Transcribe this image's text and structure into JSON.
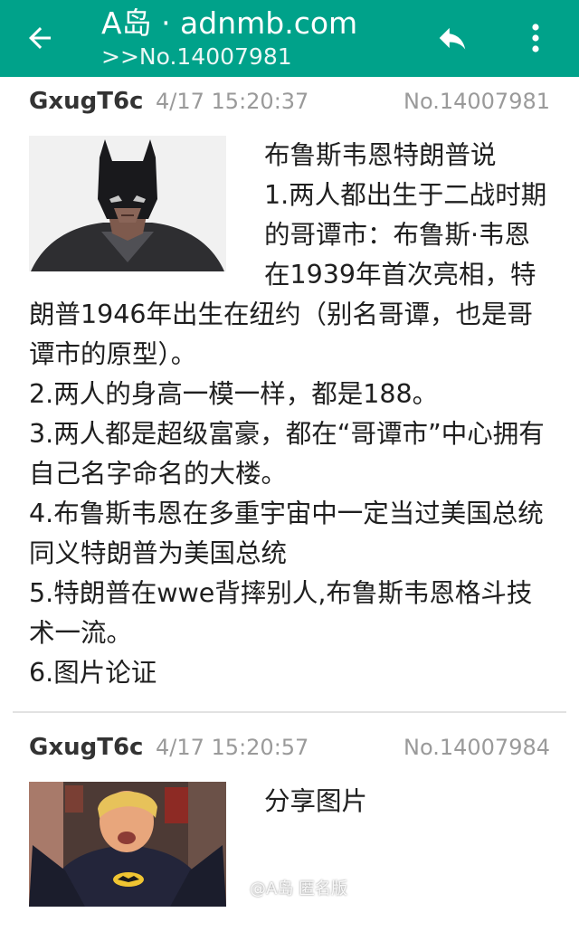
{
  "app_bar": {
    "title": "A岛 · adnmb.com",
    "subtitle": ">>No.14007981",
    "bg_color": "#00a28a",
    "icons": [
      "arrow-back-icon",
      "reply-icon",
      "more-vert-icon"
    ]
  },
  "posts": [
    {
      "user": "GxugT6c",
      "time": "4/17 15:20:37",
      "no": "No.14007981",
      "image": "batman-mask-photo",
      "lines": [
        "布鲁斯韦恩特朗普说",
        "1.两人都出生于二战时期的哥谭市：布鲁斯·韦恩在1939年首次亮相，特朗普1946年出生在纽约（别名哥谭，也是哥谭市的原型）。",
        "2.两人的身高一模一样，都是188。",
        "3.两人都是超级富豪，都在“哥谭市”中心拥有自己名字命名的大楼。",
        "4.布鲁斯韦恩在多重宇宙中一定当过美国总统同义特朗普为美国总统",
        "5.特朗普在wwe背摔别人,布鲁斯韦恩格斗技术一流。",
        "6.图片论证"
      ]
    },
    {
      "user": "GxugT6c",
      "time": "4/17 15:20:57",
      "no": "No.14007984",
      "image": "batman-costume-photo",
      "lines": [
        "分享图片"
      ]
    }
  ],
  "watermark": "@A岛 匿名版"
}
